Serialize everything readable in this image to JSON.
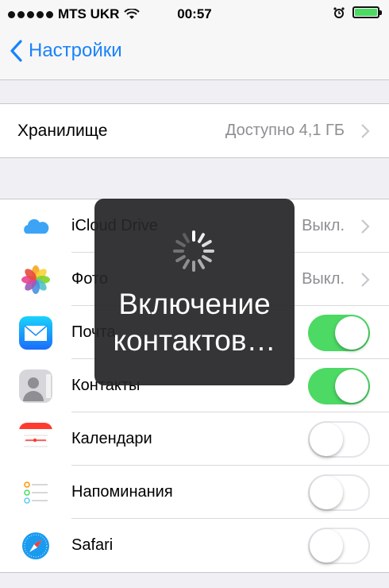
{
  "status_bar": {
    "carrier": "MTS UKR",
    "time": "00:57",
    "battery_level": 1.0,
    "icons": [
      "signal-dots-icon",
      "wifi-icon",
      "alarm-clock-icon",
      "battery-icon"
    ]
  },
  "nav": {
    "back_label": "Настройки"
  },
  "storage": {
    "label": "Хранилище",
    "value": "Доступно 4,1 ГБ"
  },
  "apps": [
    {
      "label": "iCloud Drive",
      "value": "Выкл.",
      "icon": "icloud-drive-icon"
    },
    {
      "label": "Фото",
      "value": "Выкл.",
      "icon": "photos-icon"
    },
    {
      "label": "Почта",
      "toggle": true,
      "icon": "mail-icon"
    },
    {
      "label": "Контакты",
      "toggle": true,
      "icon": "contacts-icon"
    },
    {
      "label": "Календари",
      "toggle": false,
      "icon": "calendar-icon"
    },
    {
      "label": "Напоминания",
      "toggle": false,
      "icon": "reminders-icon"
    },
    {
      "label": "Safari",
      "toggle": false,
      "icon": "safari-icon"
    }
  ],
  "hud": {
    "line1": "Включение",
    "line2": "контактов…"
  },
  "colors": {
    "accent": "#1a82fb",
    "toggle_on": "#4cd964",
    "background": "#efeff4"
  }
}
